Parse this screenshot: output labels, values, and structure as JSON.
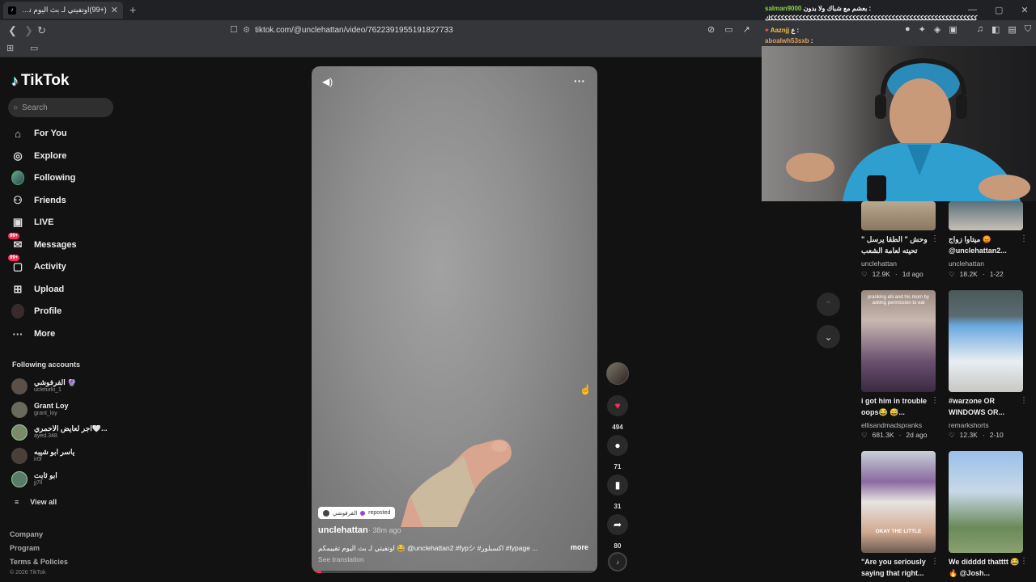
{
  "browser": {
    "tab_title": "(+99)اوتفيتي لـ بث اليوم تقييمكم",
    "url": "tiktok.com/@unclehattan/video/7622391955191827733"
  },
  "tiktok": {
    "logo": "TikTok",
    "search_placeholder": "Search",
    "nav": [
      {
        "label": "For You",
        "icon": "home-icon"
      },
      {
        "label": "Explore",
        "icon": "compass-icon"
      },
      {
        "label": "Following",
        "icon": "following-avatar-icon"
      },
      {
        "label": "Friends",
        "icon": "friends-icon"
      },
      {
        "label": "LIVE",
        "icon": "live-icon"
      },
      {
        "label": "Messages",
        "icon": "message-icon",
        "badge": "99+"
      },
      {
        "label": "Activity",
        "icon": "activity-icon",
        "badge": "99+"
      },
      {
        "label": "Upload",
        "icon": "upload-icon"
      },
      {
        "label": "Profile",
        "icon": "profile-icon"
      },
      {
        "label": "More",
        "icon": "more-icon"
      }
    ],
    "following_heading": "Following accounts",
    "following": [
      {
        "name": "الفرفوشي 🔮",
        "handle": "ucleturki_1"
      },
      {
        "name": "Grant Loy",
        "handle": "grant_loy"
      },
      {
        "name": "اجر لعايض الأحمري🤍...",
        "handle": "ayed.348"
      },
      {
        "name": "ياسر ابو شيبه",
        "handle": "ir0f"
      },
      {
        "name": "ابو ثابت",
        "handle": "jj7ll"
      }
    ],
    "view_all": "View all",
    "footer": [
      "Company",
      "Program",
      "Terms & Policies"
    ],
    "copyright": "© 2026 TikTok"
  },
  "video": {
    "repost_name": "الفرفوشي",
    "repost_label": "reposted",
    "author": "unclehattan",
    "time": "· 38m ago",
    "caption": "اوتفيتي لـ بث اليوم تقييمكم 😂 @unclehattan2 #fypシ #اكسبلور #fypage ...",
    "more": "more",
    "see_translation": "See translation",
    "likes": "494",
    "comments": "71",
    "saves": "31",
    "shares": "80"
  },
  "grid": [
    {
      "title": "وحش \" الطقا يرسل \" تحيته لعامة الشعب",
      "user": "unclehattan",
      "likes": "12.9K",
      "ago": "1d ago"
    },
    {
      "title": "ميتاوا زواج 😡 @unclehattan2...",
      "user": "unclehattan",
      "likes": "18.2K",
      "ago": "1-22"
    },
    {
      "title": "i got him in trouble oops😂 😅...",
      "user": "ellisandmadspranks",
      "likes": "681.3K",
      "ago": "2d ago"
    },
    {
      "title": "#warzone OR WINDOWS OR...",
      "user": "remarkshorts",
      "likes": "12.3K",
      "ago": "2-10"
    },
    {
      "title": "\"Are you seriously saying that right...",
      "user": "",
      "likes": "",
      "ago": ""
    },
    {
      "title": "We didddd thatttt 😂🔥 @Josh...",
      "user": "",
      "likes": "",
      "ago": ""
    }
  ],
  "thumb_captions": {
    "pranking": "pranking elli and his mom by asking permission to eat",
    "okay": "OKAY THE LITTLE"
  },
  "stream_chat": [
    {
      "user": "salman9000",
      "text": "بعشم مع شباك ولا بدون :"
    },
    {
      "user": "",
      "text": "ككككككككككككككككككككككككككككككككككككككككككككككككككككككككككك"
    },
    {
      "user": "Aaznjj",
      "text": "ع :"
    },
    {
      "user": "aboalwh53sxb",
      "text": ":"
    }
  ],
  "colors": {
    "accent": "#fe2c55",
    "background": "#121212"
  }
}
